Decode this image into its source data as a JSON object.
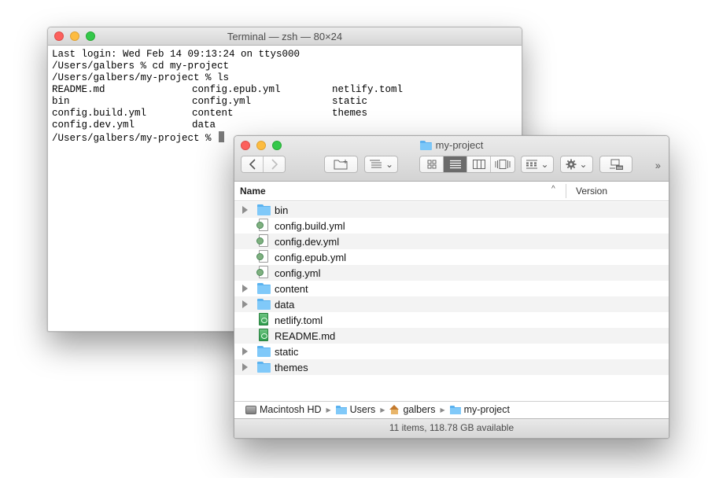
{
  "terminal": {
    "title": "Terminal — zsh — 80×24",
    "lines": [
      "Last login: Wed Feb 14 09:13:24 on ttys000",
      "/Users/galbers % cd my-project",
      "/Users/galbers/my-project % ls"
    ],
    "ls_rows": [
      [
        "README.md",
        "config.epub.yml",
        "netlify.toml"
      ],
      [
        "bin",
        "config.yml",
        "static"
      ],
      [
        "config.build.yml",
        "content",
        "themes"
      ],
      [
        "config.dev.yml",
        "data",
        ""
      ]
    ],
    "prompt": "/Users/galbers/my-project % "
  },
  "finder": {
    "title": "my-project",
    "toolbar": {
      "back_icon": "chevron-left-icon",
      "forward_icon": "chevron-right-icon",
      "new_folder_icon": "new-folder-icon",
      "arrange_icon": "arrange-icon",
      "view_icons": [
        "icon-view-icon",
        "list-view-icon",
        "column-view-icon",
        "cover-flow-icon"
      ],
      "active_view": "list",
      "group_icon": "group-icon",
      "action_icon": "gear-icon",
      "connect_icon": "connect-icon",
      "more": "››"
    },
    "columns": {
      "name": "Name",
      "version": "Version",
      "sort": "^"
    },
    "items": [
      {
        "name": "bin",
        "kind": "folder"
      },
      {
        "name": "config.build.yml",
        "kind": "yml"
      },
      {
        "name": "config.dev.yml",
        "kind": "yml"
      },
      {
        "name": "config.epub.yml",
        "kind": "yml"
      },
      {
        "name": "config.yml",
        "kind": "yml"
      },
      {
        "name": "content",
        "kind": "folder"
      },
      {
        "name": "data",
        "kind": "folder"
      },
      {
        "name": "netlify.toml",
        "kind": "text"
      },
      {
        "name": "README.md",
        "kind": "text"
      },
      {
        "name": "static",
        "kind": "folder"
      },
      {
        "name": "themes",
        "kind": "folder"
      }
    ],
    "path": [
      {
        "label": "Macintosh HD",
        "icon": "hard-drive-icon"
      },
      {
        "label": "Users",
        "icon": "folder-icon"
      },
      {
        "label": "galbers",
        "icon": "home-icon"
      },
      {
        "label": "my-project",
        "icon": "folder-icon"
      }
    ],
    "status": "11 items, 118.78 GB available"
  }
}
